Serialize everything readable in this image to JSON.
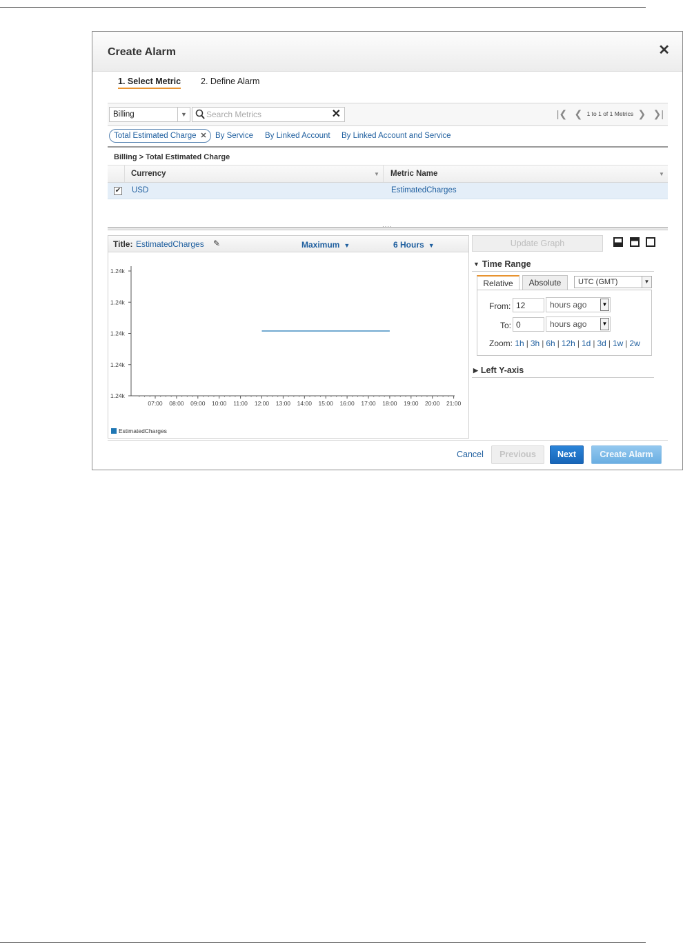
{
  "dialog": {
    "title": "Create Alarm",
    "steps": [
      "1. Select Metric",
      "2. Define Alarm"
    ]
  },
  "toolbar": {
    "namespace": "Billing",
    "search_placeholder": "Search Metrics",
    "pager_text": "1 to 1 of 1 Metrics"
  },
  "filters": {
    "active": "Total Estimated Charge",
    "links": [
      "By Service",
      "By Linked Account",
      "By Linked Account and Service"
    ]
  },
  "breadcrumb": "Billing > Total Estimated Charge",
  "grid": {
    "columns": [
      "Currency",
      "Metric Name"
    ],
    "rows": [
      {
        "checked": true,
        "currency": "USD",
        "metric": "EstimatedCharges"
      }
    ]
  },
  "graph": {
    "title_label": "Title:",
    "title_value": "EstimatedCharges",
    "statistic": "Maximum",
    "period": "6 Hours",
    "legend": "EstimatedCharges",
    "line_color": "#1f77b4"
  },
  "chart_data": {
    "type": "line",
    "x_ticks": [
      "07:00",
      "08:00",
      "09:00",
      "10:00",
      "11:00",
      "12:00",
      "13:00",
      "14:00",
      "15:00",
      "16:00",
      "17:00",
      "18:00",
      "19:00",
      "20:00",
      "21:00"
    ],
    "y_ticks": [
      "1.24k",
      "1.24k",
      "1.24k",
      "1.24k",
      "1.24k"
    ],
    "series": [
      {
        "name": "EstimatedCharges",
        "x": [
          "12:00",
          "18:00"
        ],
        "y_level_fraction": 0.5
      }
    ],
    "grid": false,
    "legend_placement": "bottom-left"
  },
  "side": {
    "update_label": "Update Graph",
    "time_range_title": "Time Range",
    "tabs": [
      "Relative",
      "Absolute"
    ],
    "timezone": "UTC (GMT)",
    "from_label": "From:",
    "from_value": "12",
    "from_unit": "hours ago",
    "to_label": "To:",
    "to_value": "0",
    "to_unit": "hours ago",
    "zoom_label": "Zoom:",
    "zoom_options": [
      "1h",
      "3h",
      "6h",
      "12h",
      "1d",
      "3d",
      "1w",
      "2w"
    ],
    "left_axis_title": "Left Y-axis"
  },
  "footer": {
    "cancel": "Cancel",
    "previous": "Previous",
    "next": "Next",
    "create": "Create Alarm"
  }
}
